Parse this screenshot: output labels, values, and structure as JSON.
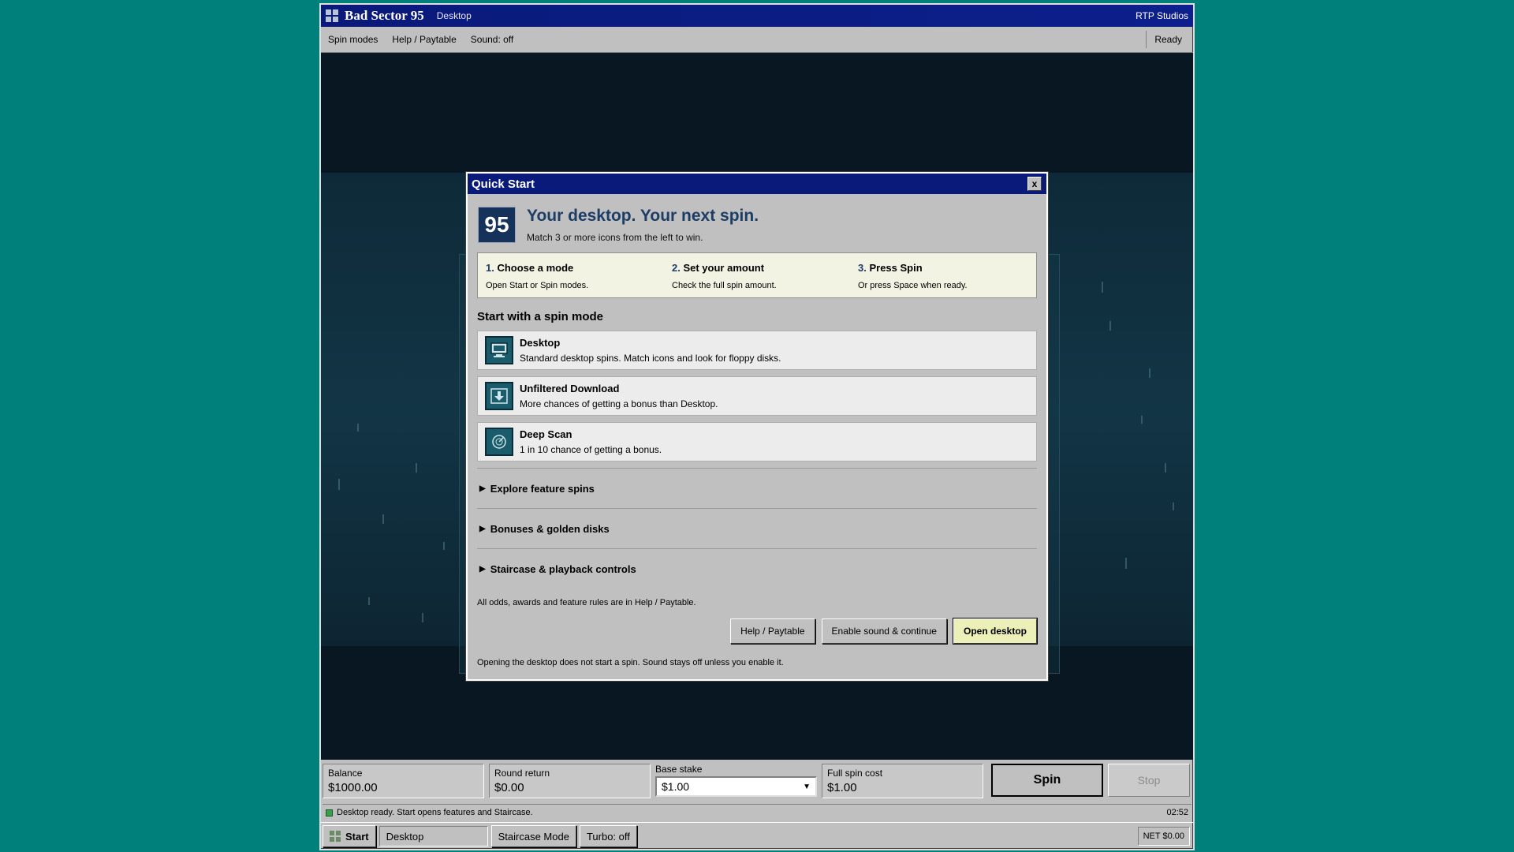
{
  "app": {
    "title": "Bad Sector 95",
    "subtitle": "Desktop",
    "studio": "RTP Studios"
  },
  "menu": {
    "items": [
      "Spin modes",
      "Help / Paytable",
      "Sound: off"
    ],
    "status": "Ready"
  },
  "dialog": {
    "title": "Quick Start",
    "close_label": "x",
    "badge": "95",
    "heading": "Your desktop. Your next spin.",
    "subheading": "Match 3 or more icons from the left to win.",
    "steps": [
      {
        "num": "1.",
        "title": "Choose a mode",
        "desc": "Open Start or Spin modes."
      },
      {
        "num": "2.",
        "title": "Set your amount",
        "desc": "Check the full spin amount."
      },
      {
        "num": "3.",
        "title": "Press Spin",
        "desc": "Or press Space when ready."
      }
    ],
    "section_title": "Start with a spin mode",
    "modes": [
      {
        "name": "Desktop",
        "desc": "Standard desktop spins. Match icons and look for floppy disks.",
        "icon": "monitor-icon"
      },
      {
        "name": "Unfiltered Download",
        "desc": "More chances of getting a bonus than Desktop.",
        "icon": "download-icon"
      },
      {
        "name": "Deep Scan",
        "desc": "1 in 10 chance of getting a bonus.",
        "icon": "radar-icon"
      }
    ],
    "accordion": [
      "Explore feature spins",
      "Bonuses & golden disks",
      "Staircase & playback controls"
    ],
    "footnote": "All odds, awards and feature rules are in Help / Paytable.",
    "buttons": {
      "help": "Help / Paytable",
      "enable_sound": "Enable sound & continue",
      "open_desktop": "Open desktop"
    },
    "note": "Opening the desktop does not start a spin. Sound stays off unless you enable it."
  },
  "controls": {
    "balance_label": "Balance",
    "balance_value": "$1000.00",
    "round_label": "Round return",
    "round_value": "$0.00",
    "stake_label": "Base stake",
    "stake_value": "$1.00",
    "cost_label": "Full spin cost",
    "cost_value": "$1.00",
    "spin_label": "Spin",
    "stop_label": "Stop"
  },
  "status": {
    "message": "Desktop ready. Start opens features and Staircase.",
    "time": "02:52"
  },
  "taskbar": {
    "start": "Start",
    "desktop": "Desktop",
    "staircase": "Staircase Mode",
    "turbo": "Turbo: off",
    "net": "NET $0.00"
  }
}
